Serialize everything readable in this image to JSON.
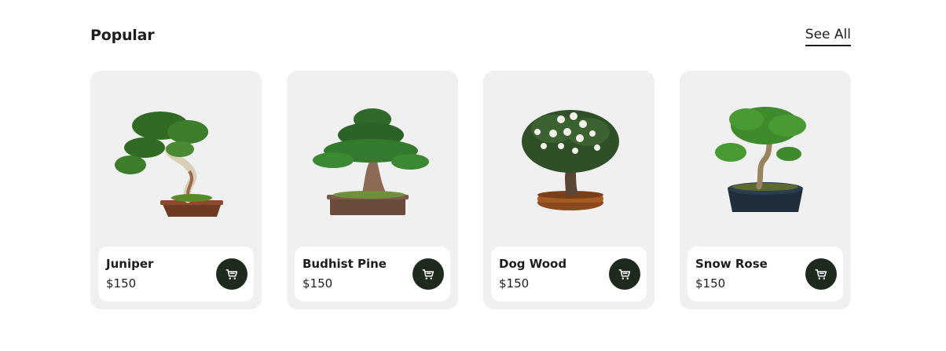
{
  "section": {
    "title": "Popular",
    "see_all_label": "See All"
  },
  "products": [
    {
      "name": "Juniper",
      "price": "$150",
      "image_icon": "juniper-bonsai"
    },
    {
      "name": "Budhist Pine",
      "price": "$150",
      "image_icon": "pine-bonsai"
    },
    {
      "name": "Dog Wood",
      "price": "$150",
      "image_icon": "dogwood-bonsai"
    },
    {
      "name": "Snow Rose",
      "price": "$150",
      "image_icon": "snow-rose-bonsai"
    }
  ],
  "colors": {
    "card_background": "#f0f0f0",
    "cart_button": "#1f2a1e",
    "text": "#1b1f1a"
  }
}
